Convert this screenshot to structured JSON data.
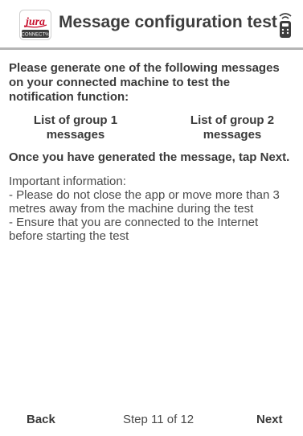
{
  "header": {
    "title": "Message configuration test",
    "logo": {
      "brand_text": "jura",
      "sub_text": "CONNECT%",
      "brand_color": "#c8102e"
    },
    "right_icon": "remote-control-icon"
  },
  "content": {
    "intro": "Please generate one of the following messages on your connected machine to test the notification function:",
    "group_links": [
      "List of group 1 messages",
      "List of group 2 messages"
    ],
    "next_instruction": "Once you have generated the message, tap Next.",
    "info_title": "Important information:",
    "info_lines": [
      "- Please do not close the app or move more than 3 metres away from the machine during the test",
      "- Ensure that you are connected to the Internet before starting the test"
    ]
  },
  "footer": {
    "back_label": "Back",
    "step_text": "Step 11 of 12",
    "next_label": "Next"
  },
  "colors": {
    "text": "#3a3a3a",
    "divider": "#b5b5b5",
    "background": "#ffffff"
  }
}
